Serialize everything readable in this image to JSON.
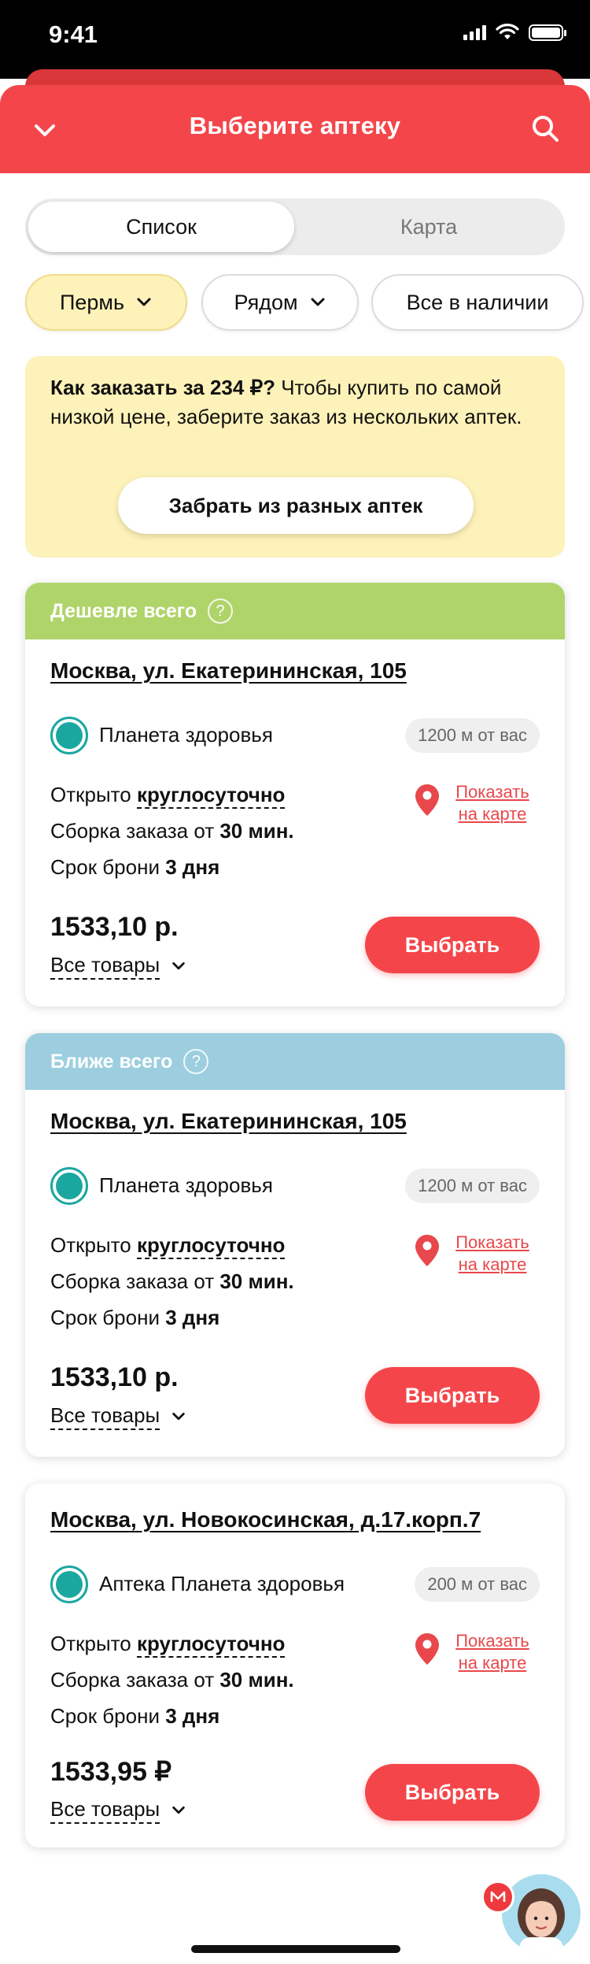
{
  "status_bar": {
    "time": "9:41"
  },
  "header": {
    "title": "Выберите аптеку"
  },
  "view_toggle": {
    "list_label": "Список",
    "map_label": "Карта",
    "active": "list"
  },
  "filters": {
    "city": "Пермь",
    "near": "Рядом",
    "stock": "Все в наличии"
  },
  "info": {
    "bold_text": "Как заказать за 234 ₽?",
    "text": " Чтобы купить по самой низкой цене, заберите заказ из нескольких аптек.",
    "button_label": "Забрать из разных аптек"
  },
  "common": {
    "open_prefix": "Открыто ",
    "open_hours": "круглосуточно",
    "assembly_prefix": "Сборка заказа от ",
    "assembly_time": "30 мин.",
    "reserve_prefix": "Срок брони ",
    "reserve_time": "3 дня",
    "map_link_line1": "Показать",
    "map_link_line2": "на карте",
    "all_goods": "Все товары",
    "select_button": "Выбрать"
  },
  "cards": [
    {
      "badge": "Дешевле всего",
      "badge_color": "#afd46a",
      "address": "Москва, ул. Екатерининская, 105",
      "brand": "Планета здоровья",
      "distance": "1200 м от вас",
      "price": "1533,10 р."
    },
    {
      "badge": "Ближе всего",
      "badge_color": "#9ccedf",
      "address": "Москва, ул. Екатерининская, 105",
      "brand": "Планета здоровья",
      "distance": "1200 м от вас",
      "price": "1533,10 р."
    },
    {
      "badge": "",
      "address": "Москва, ул. Новокосинская, д.17.корп.7",
      "brand": "Аптека Планета здоровья",
      "distance": "200 м от вас",
      "price": "1533,95 ₽"
    }
  ],
  "colors": {
    "accent": "#f4464a",
    "info_bg": "#fdf2b9",
    "brand_teal": "#1aa7a0"
  }
}
